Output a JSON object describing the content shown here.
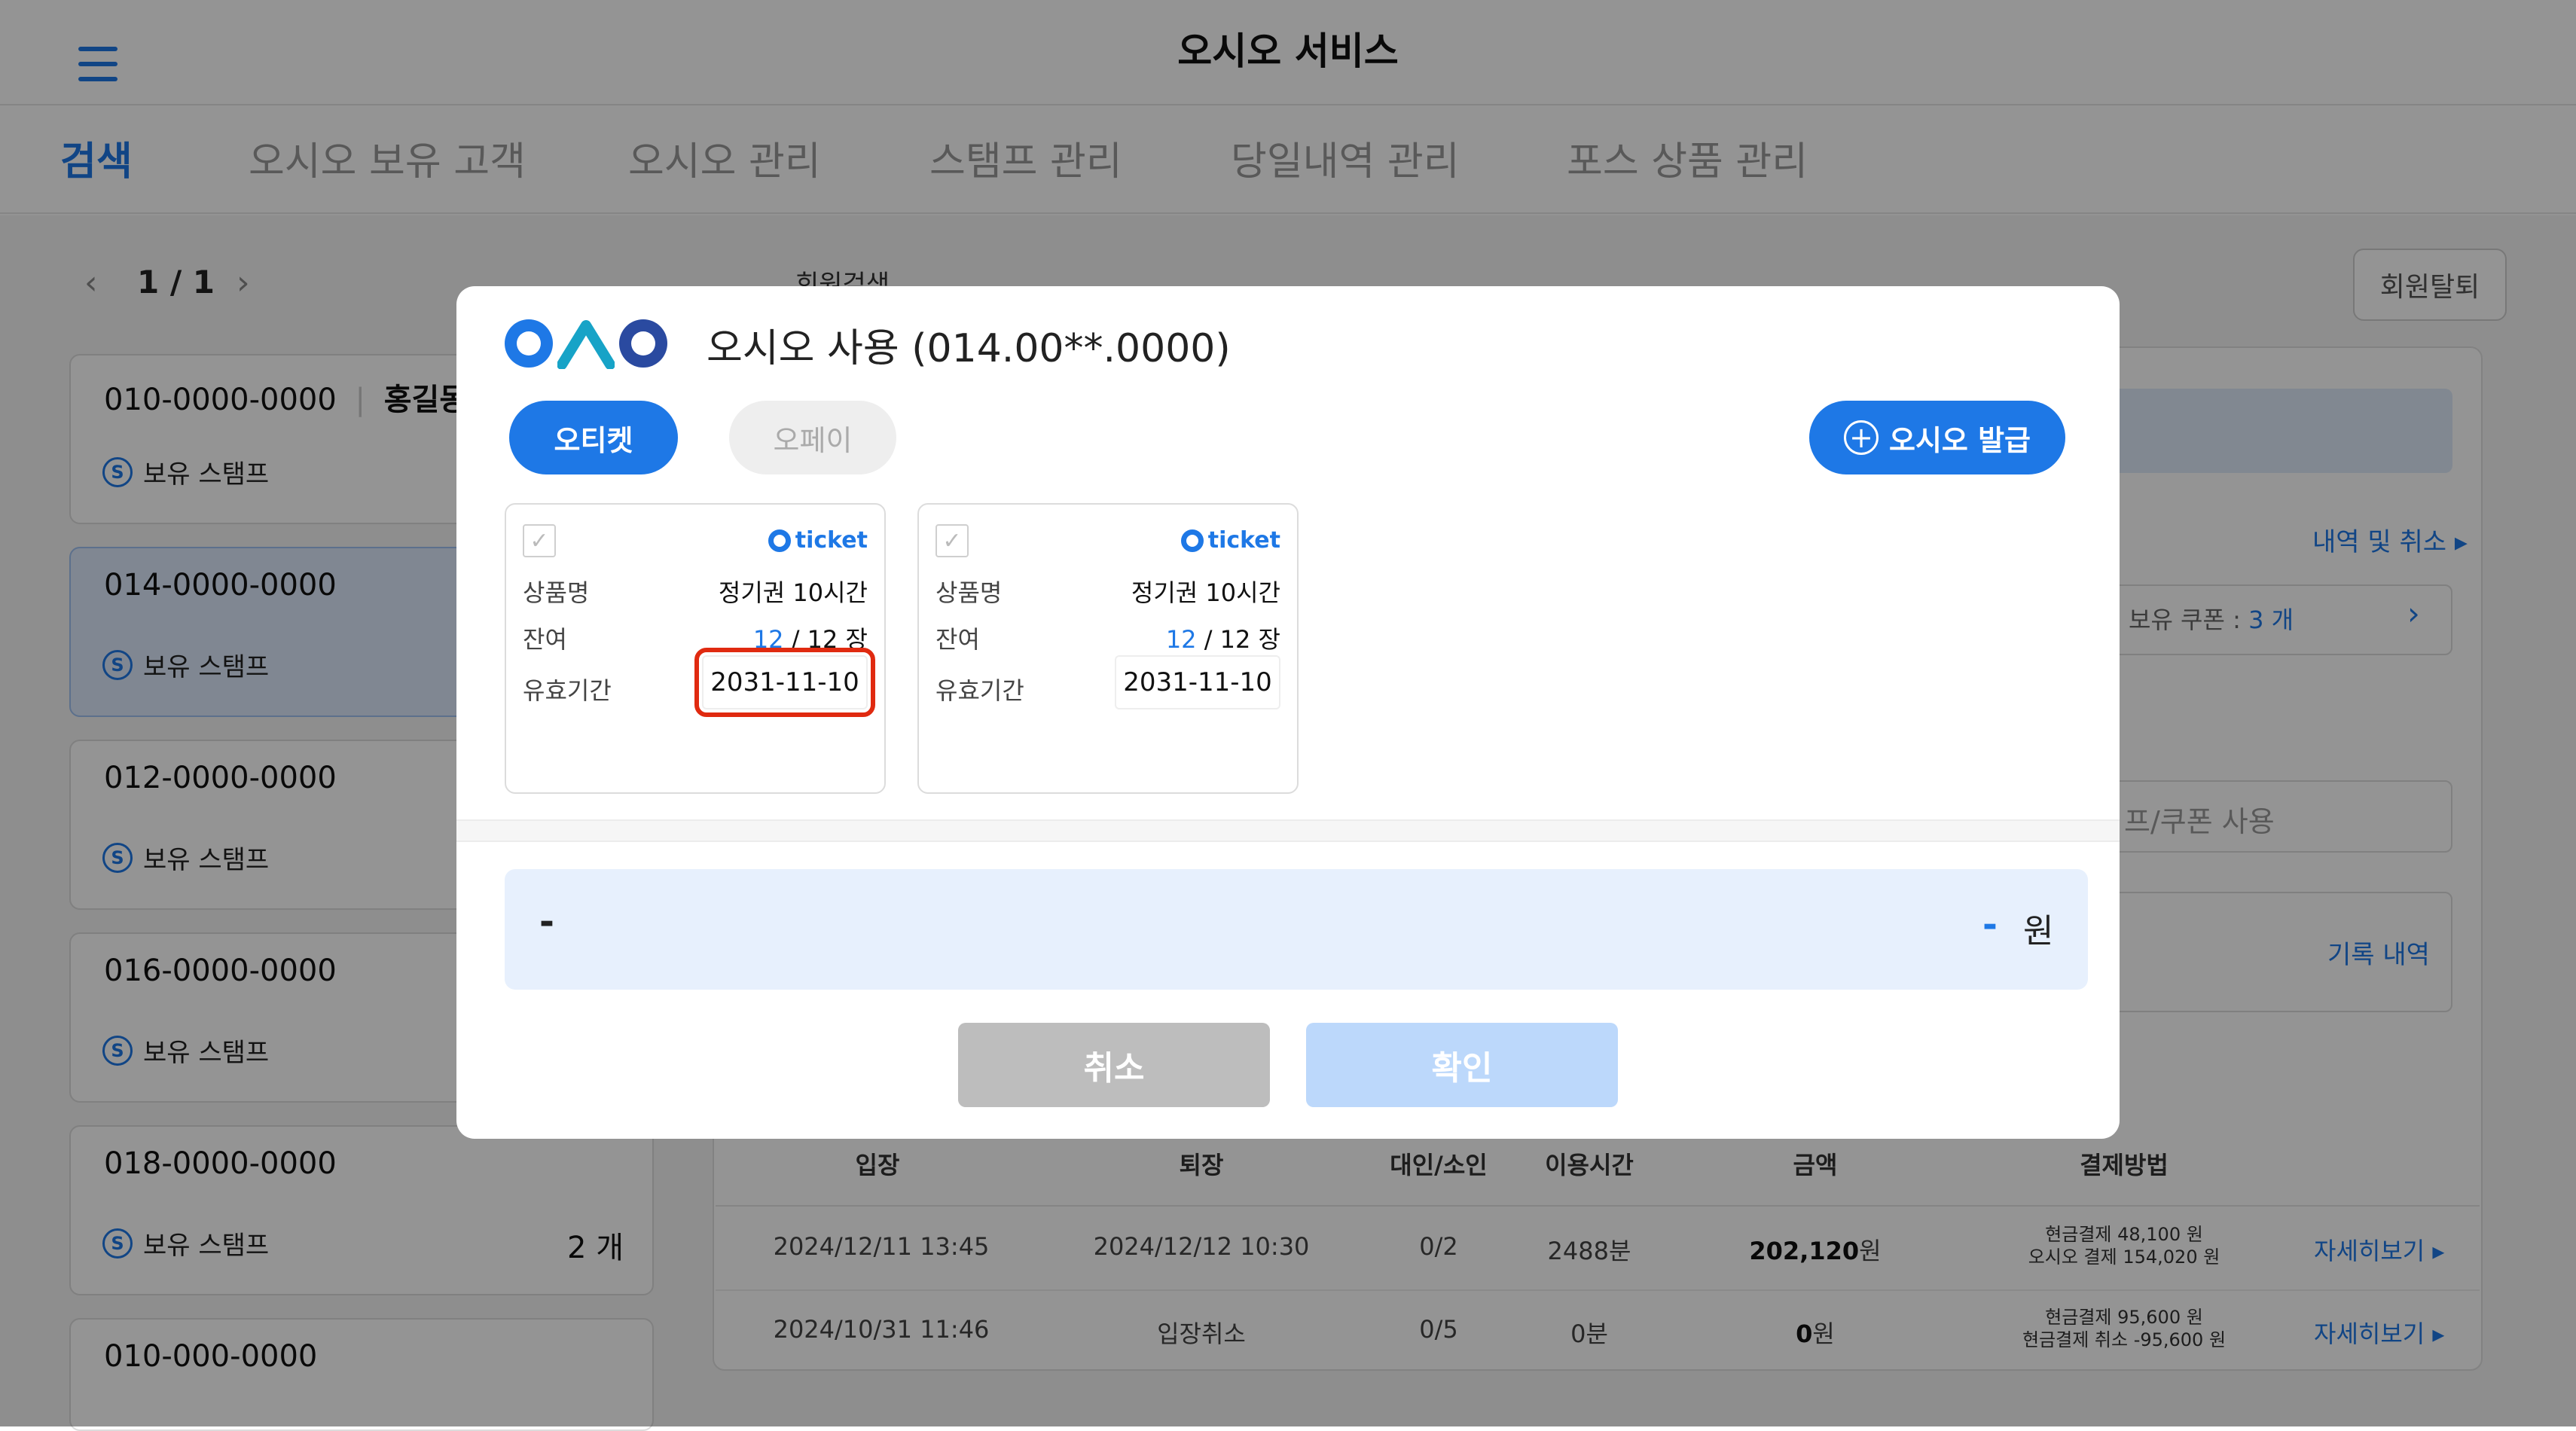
{
  "header": {
    "title": "오시오 서비스"
  },
  "nav": {
    "tabs": [
      {
        "label": "검색"
      },
      {
        "label": "오시오 보유 고객"
      },
      {
        "label": "오시오 관리"
      },
      {
        "label": "스탬프 관리"
      },
      {
        "label": "당일내역 관리"
      },
      {
        "label": "포스 상품 관리"
      }
    ]
  },
  "sidebar": {
    "pager": {
      "prev": "‹",
      "text": "1 / 1",
      "next": "›"
    },
    "customers": [
      {
        "phone": "010-0000-0000",
        "name": "홍길동",
        "stamp_label": "보유 스탬프",
        "count": ""
      },
      {
        "phone": "014-0000-0000",
        "name": "",
        "stamp_label": "보유 스탬프",
        "count": ""
      },
      {
        "phone": "012-0000-0000",
        "name": "",
        "stamp_label": "보유 스탬프",
        "count": ""
      },
      {
        "phone": "016-0000-0000",
        "name": "",
        "stamp_label": "보유 스탬프",
        "count": ""
      },
      {
        "phone": "018-0000-0000",
        "name": "",
        "stamp_label": "보유 스탬프",
        "count": "2 개"
      },
      {
        "phone": "010-000-0000",
        "name": "",
        "stamp_label": "",
        "count": ""
      }
    ]
  },
  "main": {
    "back_label": "회원검색",
    "withdraw_button": "회원탈퇴",
    "history_link": "내역 및 취소",
    "coupon_text_prefix": "보유 쿠폰 : ",
    "coupon_count": "3 개",
    "use_label": "프/쿠폰 사용",
    "record_link": "기록 내역",
    "table": {
      "headers": [
        "입장",
        "퇴장",
        "대인/소인",
        "이용시간",
        "금액",
        "결제방법"
      ],
      "rows": [
        {
          "in": "2024/12/11 13:45",
          "out": "2024/12/12 10:30",
          "people": "0/2",
          "time": "2488분",
          "amount": "202,120",
          "unit": "원",
          "pay1": "현금결제 48,100 원",
          "pay2": "오시오 결제 154,020 원",
          "detail": "자세히보기"
        },
        {
          "in": "2024/10/31 11:46",
          "out": "입장취소",
          "people": "0/5",
          "time": "0분",
          "amount": "0",
          "unit": "원",
          "pay1": "현금결제 95,600 원",
          "pay2": "현금결제 취소 -95,600 원",
          "detail": "자세히보기"
        }
      ]
    }
  },
  "modal": {
    "title": "오시오 사용 (014.00**.0000)",
    "tab_active": "오티켓",
    "tab_inactive": "오페이",
    "issue_button": "오시오 발급",
    "tickets": [
      {
        "brand": "ticket",
        "name_label": "상품명",
        "name": "정기권 10시간",
        "remain_label": "잔여",
        "remain": "12",
        "remain_total": " / 12 장",
        "expiry_label": "유효기간",
        "expiry": "2031-11-10"
      },
      {
        "brand": "ticket",
        "name_label": "상품명",
        "name": "정기권 10시간",
        "remain_label": "잔여",
        "remain": "12",
        "remain_total": " / 12 장",
        "expiry_label": "유효기간",
        "expiry": "2031-11-10"
      }
    ],
    "amount_left": "-",
    "amount_value": "-",
    "amount_unit": "원",
    "cancel_button": "취소",
    "confirm_button": "확인"
  },
  "colors": {
    "accent": "#1e78e6",
    "highlight": "#e02a10"
  }
}
